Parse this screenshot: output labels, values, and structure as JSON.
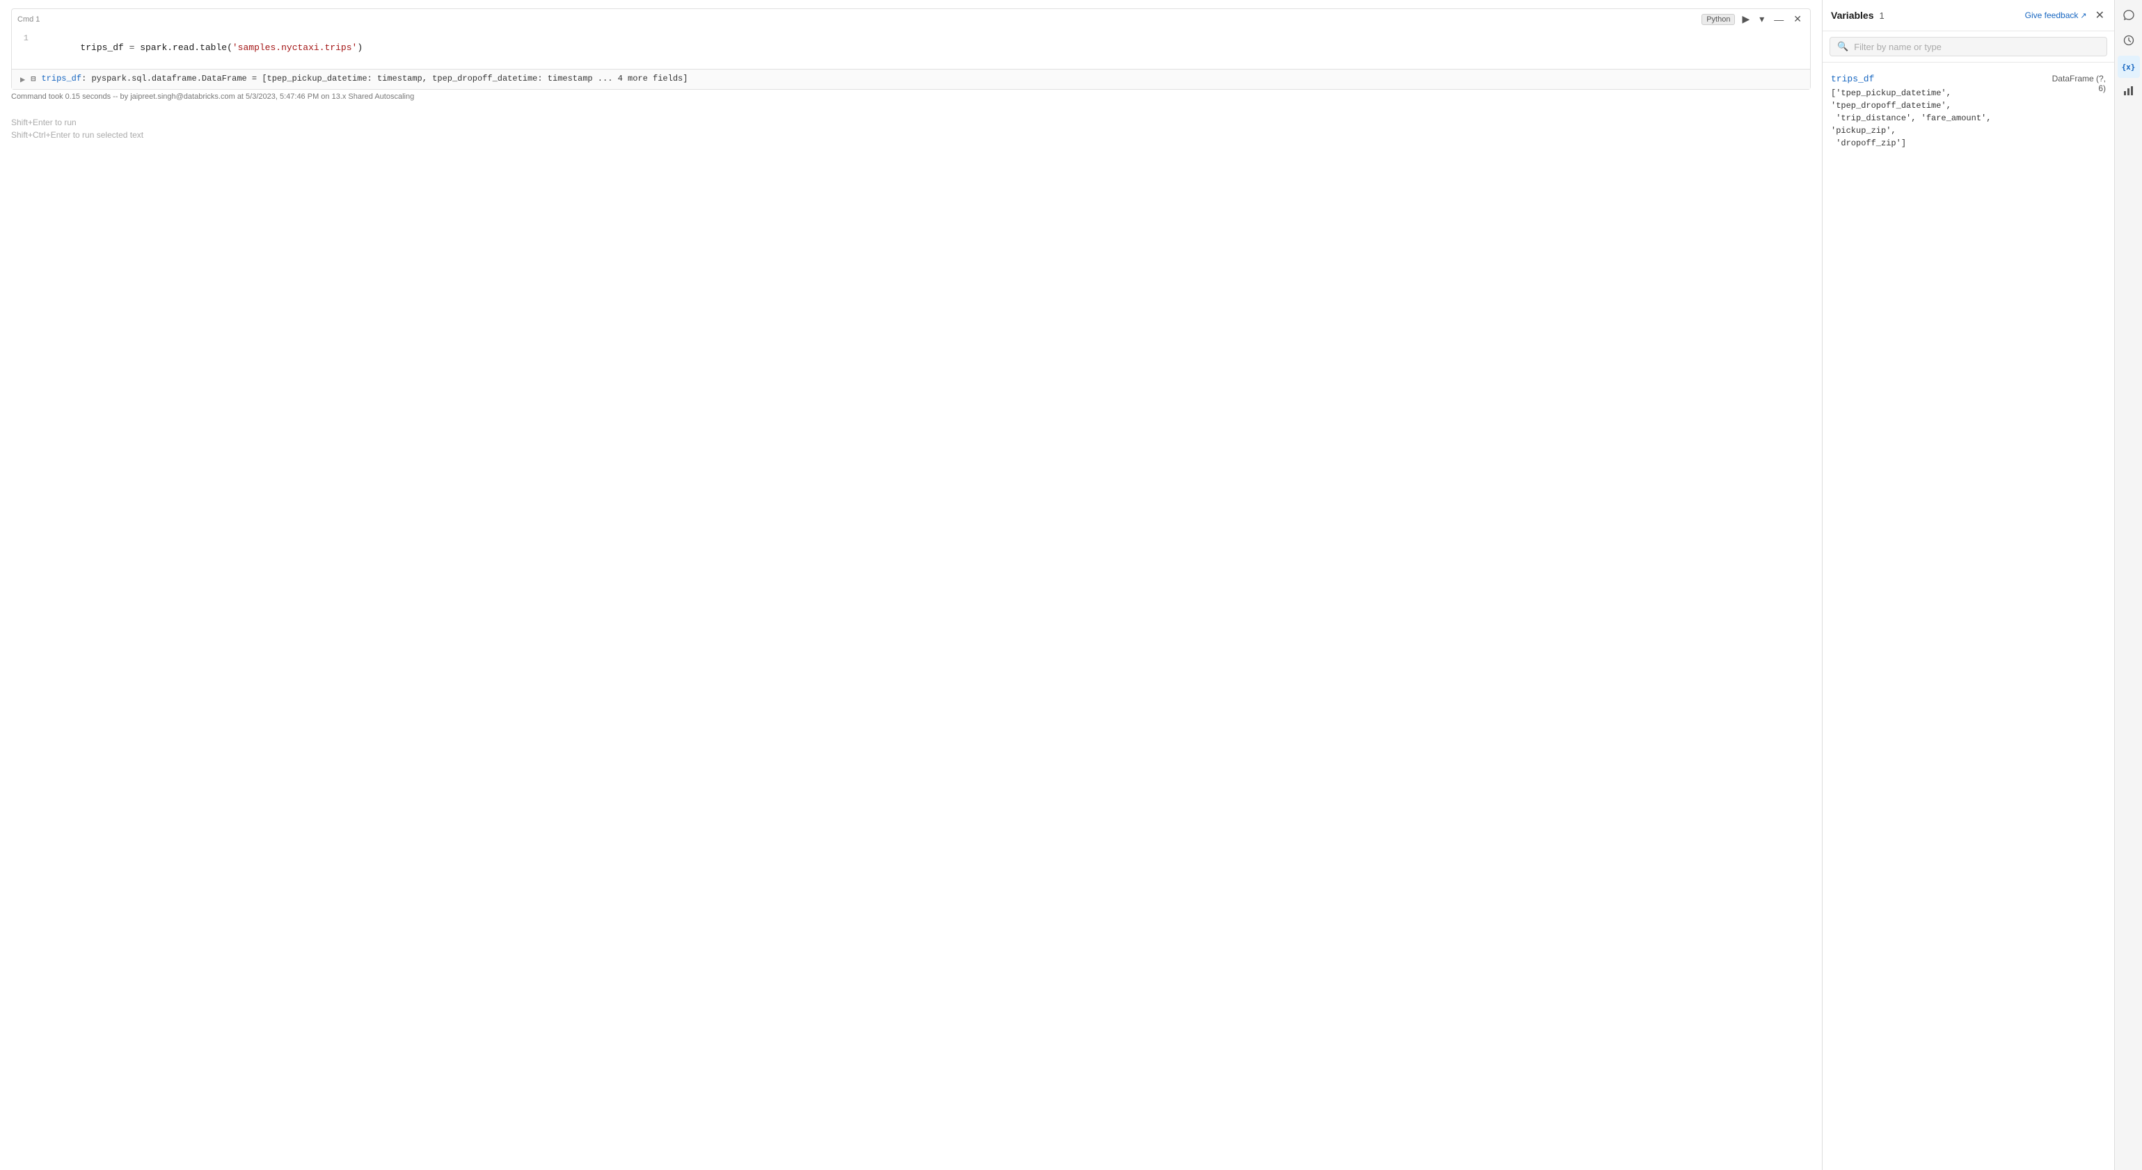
{
  "notebook": {
    "cell": {
      "cmd_label": "Cmd 1",
      "language": "Python",
      "line_number": "1",
      "code": "trips_df = spark.read.table('samples.nyctaxi.trips')",
      "output": {
        "arrow": "▶",
        "icon": "⊟",
        "variable_name": "trips_df",
        "colon": ":",
        "type_info": "pyspark.sql.dataframe.DataFrame = [tpep_pickup_datetime: timestamp, tpep_dropoff_datetime: timestamp ... 4 more fields]"
      },
      "status": "Command took 0.15 seconds -- by jaipreet.singh@databricks.com at 5/3/2023, 5:47:46 PM on 13.x Shared Autoscaling"
    },
    "empty_hints": [
      "Shift+Enter to run",
      "Shift+Ctrl+Enter to run selected text"
    ]
  },
  "variables_panel": {
    "title": "Variables",
    "count": "1",
    "feedback_label": "Give feedback",
    "search_placeholder": "Filter by name or type",
    "variable": {
      "name": "trips_df",
      "type": "DataFrame (?, 6)",
      "value": "['tpep_pickup_datetime', 'tpep_dropoff_datetime',\n 'trip_distance', 'fare_amount', 'pickup_zip',\n 'dropoff_zip']"
    }
  },
  "right_sidebar": {
    "icons": [
      {
        "name": "chat-icon",
        "symbol": "💬",
        "active": false
      },
      {
        "name": "history-icon",
        "symbol": "🕐",
        "active": false
      },
      {
        "name": "variables-icon",
        "symbol": "{x}",
        "active": true
      },
      {
        "name": "chart-icon",
        "symbol": "📊",
        "active": false
      }
    ]
  },
  "toolbar": {
    "run_icon": "▶",
    "dropdown_icon": "▾",
    "minimize_icon": "—",
    "close_icon": "✕"
  }
}
